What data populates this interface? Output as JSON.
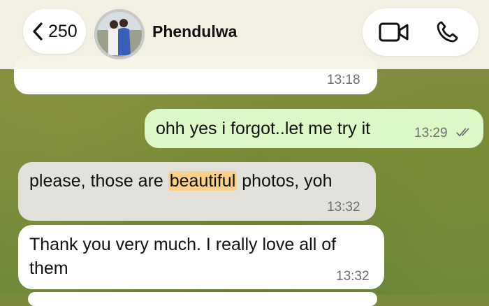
{
  "header": {
    "back_count": "250",
    "contact_name": "Phendulwa",
    "icons": {
      "back": "chevron-left-icon",
      "video": "video-camera-icon",
      "call": "phone-icon"
    }
  },
  "messages": [
    {
      "id": "m1",
      "direction": "incoming",
      "text": "",
      "time": "13:18"
    },
    {
      "id": "m2",
      "direction": "outgoing",
      "text": "ohh yes i forgot..let me try it",
      "time": "13:29",
      "status": "read"
    },
    {
      "id": "m3",
      "direction": "incoming",
      "text_before": "please, those are ",
      "text_highlight": "beautiful",
      "text_after": " photos, yoh",
      "time": "13:32"
    },
    {
      "id": "m4",
      "direction": "incoming",
      "text_line1": "Thank you very much. I really love all of",
      "text_line2": "them",
      "time": "13:32"
    }
  ],
  "colors": {
    "header_bg": "#f6f3e8",
    "outgoing_bubble": "#dcf8c6",
    "incoming_bubble": "#ffffff",
    "highlight": "#fcd088",
    "read_ticks": "#6e6e6e"
  }
}
